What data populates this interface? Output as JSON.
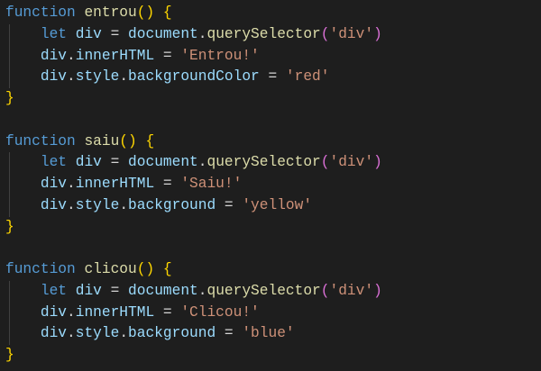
{
  "colors": {
    "background": "#1e1e1e",
    "keyword": "#569cd6",
    "function": "#dcdcaa",
    "variable": "#9cdcfe",
    "string": "#ce9178",
    "bracket1": "#ffd700",
    "bracket2": "#da70d6"
  },
  "code_lines": [
    {
      "guide": false,
      "tokens": [
        [
          "function",
          "kw"
        ],
        [
          " ",
          "op"
        ],
        [
          "entrou",
          "fn"
        ],
        [
          "()",
          "p1"
        ],
        [
          " ",
          "op"
        ],
        [
          "{",
          "p1"
        ]
      ]
    },
    {
      "guide": true,
      "tokens": [
        [
          "    ",
          "op"
        ],
        [
          "let",
          "kw"
        ],
        [
          " ",
          "op"
        ],
        [
          "div",
          "var"
        ],
        [
          " = ",
          "op"
        ],
        [
          "document",
          "var"
        ],
        [
          ".",
          "op"
        ],
        [
          "querySelector",
          "fn"
        ],
        [
          "(",
          "p2"
        ],
        [
          "'div'",
          "str"
        ],
        [
          ")",
          "p2"
        ]
      ]
    },
    {
      "guide": true,
      "tokens": [
        [
          "    ",
          "op"
        ],
        [
          "div",
          "var"
        ],
        [
          ".",
          "op"
        ],
        [
          "innerHTML",
          "var"
        ],
        [
          " = ",
          "op"
        ],
        [
          "'Entrou!'",
          "str"
        ]
      ]
    },
    {
      "guide": true,
      "tokens": [
        [
          "    ",
          "op"
        ],
        [
          "div",
          "var"
        ],
        [
          ".",
          "op"
        ],
        [
          "style",
          "var"
        ],
        [
          ".",
          "op"
        ],
        [
          "backgroundColor",
          "var"
        ],
        [
          " = ",
          "op"
        ],
        [
          "'red'",
          "str"
        ]
      ]
    },
    {
      "guide": false,
      "tokens": [
        [
          "}",
          "p1"
        ]
      ]
    },
    {
      "guide": false,
      "tokens": []
    },
    {
      "guide": false,
      "tokens": [
        [
          "function",
          "kw"
        ],
        [
          " ",
          "op"
        ],
        [
          "saiu",
          "fn"
        ],
        [
          "()",
          "p1"
        ],
        [
          " ",
          "op"
        ],
        [
          "{",
          "p1"
        ]
      ]
    },
    {
      "guide": true,
      "tokens": [
        [
          "    ",
          "op"
        ],
        [
          "let",
          "kw"
        ],
        [
          " ",
          "op"
        ],
        [
          "div",
          "var"
        ],
        [
          " = ",
          "op"
        ],
        [
          "document",
          "var"
        ],
        [
          ".",
          "op"
        ],
        [
          "querySelector",
          "fn"
        ],
        [
          "(",
          "p2"
        ],
        [
          "'div'",
          "str"
        ],
        [
          ")",
          "p2"
        ]
      ]
    },
    {
      "guide": true,
      "tokens": [
        [
          "    ",
          "op"
        ],
        [
          "div",
          "var"
        ],
        [
          ".",
          "op"
        ],
        [
          "innerHTML",
          "var"
        ],
        [
          " = ",
          "op"
        ],
        [
          "'Saiu!'",
          "str"
        ]
      ]
    },
    {
      "guide": true,
      "tokens": [
        [
          "    ",
          "op"
        ],
        [
          "div",
          "var"
        ],
        [
          ".",
          "op"
        ],
        [
          "style",
          "var"
        ],
        [
          ".",
          "op"
        ],
        [
          "background",
          "var"
        ],
        [
          " = ",
          "op"
        ],
        [
          "'yellow'",
          "str"
        ]
      ]
    },
    {
      "guide": false,
      "tokens": [
        [
          "}",
          "p1"
        ]
      ]
    },
    {
      "guide": false,
      "tokens": []
    },
    {
      "guide": false,
      "tokens": [
        [
          "function",
          "kw"
        ],
        [
          " ",
          "op"
        ],
        [
          "clicou",
          "fn"
        ],
        [
          "()",
          "p1"
        ],
        [
          " ",
          "op"
        ],
        [
          "{",
          "p1"
        ]
      ]
    },
    {
      "guide": true,
      "tokens": [
        [
          "    ",
          "op"
        ],
        [
          "let",
          "kw"
        ],
        [
          " ",
          "op"
        ],
        [
          "div",
          "var"
        ],
        [
          " = ",
          "op"
        ],
        [
          "document",
          "var"
        ],
        [
          ".",
          "op"
        ],
        [
          "querySelector",
          "fn"
        ],
        [
          "(",
          "p2"
        ],
        [
          "'div'",
          "str"
        ],
        [
          ")",
          "p2"
        ]
      ]
    },
    {
      "guide": true,
      "tokens": [
        [
          "    ",
          "op"
        ],
        [
          "div",
          "var"
        ],
        [
          ".",
          "op"
        ],
        [
          "innerHTML",
          "var"
        ],
        [
          " = ",
          "op"
        ],
        [
          "'Clicou!'",
          "str"
        ]
      ]
    },
    {
      "guide": true,
      "tokens": [
        [
          "    ",
          "op"
        ],
        [
          "div",
          "var"
        ],
        [
          ".",
          "op"
        ],
        [
          "style",
          "var"
        ],
        [
          ".",
          "op"
        ],
        [
          "background",
          "var"
        ],
        [
          " = ",
          "op"
        ],
        [
          "'blue'",
          "str"
        ]
      ]
    },
    {
      "guide": false,
      "tokens": [
        [
          "}",
          "p1"
        ]
      ]
    }
  ]
}
